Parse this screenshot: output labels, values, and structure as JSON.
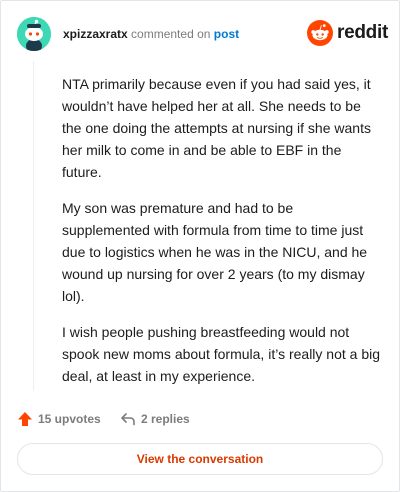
{
  "header": {
    "username": "xpizzaxratx",
    "middle_text": "commented on",
    "post_link": "post",
    "brand": "reddit"
  },
  "comment": {
    "paragraphs": [
      "NTA primarily because even if you had said yes, it wouldn’t have helped her at all. She needs to be the one doing the attempts at nursing if she wants her milk to come in and be able to EBF in the future.",
      "My son was premature and had to be supplemented with formula from time to time just due to logistics when he was in the NICU, and he wound up nursing for over 2 years (to my dismay lol).",
      "I wish people pushing breastfeeding would not spook new moms about formula, it’s really not a big deal, at least in my experience."
    ]
  },
  "actions": {
    "upvotes": "15 upvotes",
    "replies": "2 replies"
  },
  "cta": {
    "label": "View the conversation"
  },
  "colors": {
    "accent": "#d93a00",
    "upvote": "#ff4500",
    "avatar": "#3ed8b4",
    "link": "#0079d3"
  },
  "icons": {
    "avatar": "snoo-avatar-icon",
    "logo": "reddit-logo-icon",
    "upvote": "upvote-arrow-icon",
    "reply": "reply-arrow-icon"
  }
}
